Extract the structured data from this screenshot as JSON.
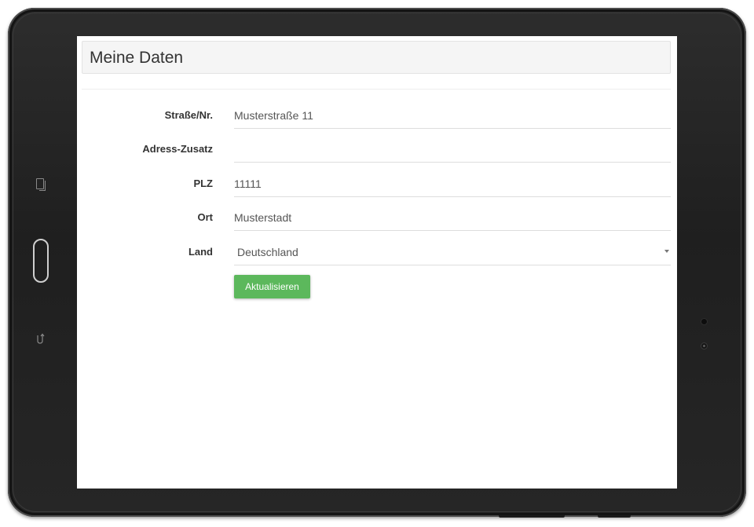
{
  "colors": {
    "accent": "#5cb85c",
    "header_bg": "#f5f5f5",
    "device_frame": "#262626"
  },
  "device": {
    "icons": {
      "recent_apps": "recent-apps-icon",
      "home": "home-button",
      "back": "back-icon"
    }
  },
  "page": {
    "title": "Meine Daten"
  },
  "form": {
    "fields": [
      {
        "label": "Straße/Nr.",
        "value": "Musterstraße 11",
        "placeholder": ""
      },
      {
        "label": "Adress-Zusatz",
        "value": "",
        "placeholder": ""
      },
      {
        "label": "PLZ",
        "value": "11111",
        "placeholder": ""
      },
      {
        "label": "Ort",
        "value": "Musterstadt",
        "placeholder": ""
      }
    ],
    "country": {
      "label": "Land",
      "selected": "Deutschland",
      "icon": "chevron-down-icon"
    },
    "submit_label": "Aktualisieren"
  }
}
